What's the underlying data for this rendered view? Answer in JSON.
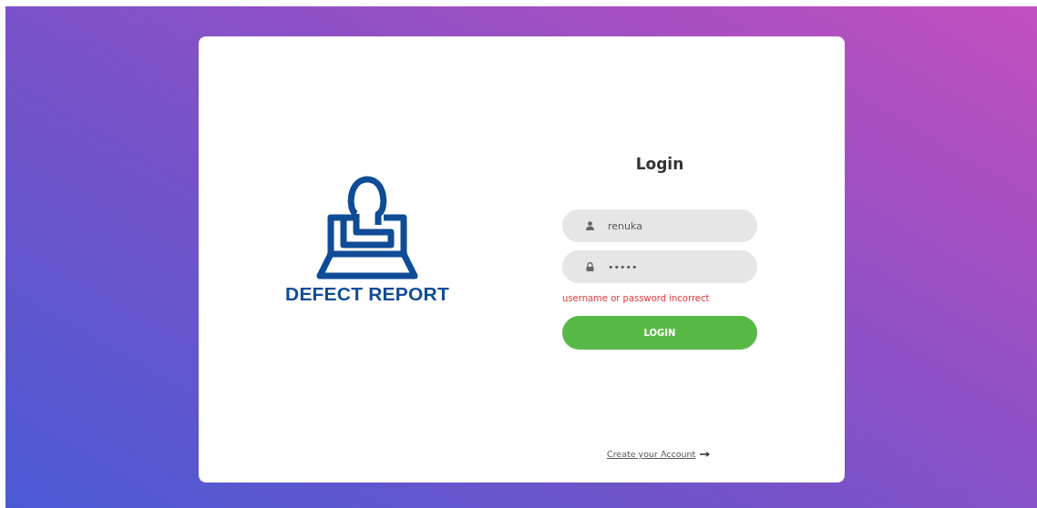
{
  "logo": {
    "text": "DEFECT REPORT"
  },
  "form": {
    "title": "Login",
    "fields": [
      {
        "kind": "user",
        "value": "renuka"
      },
      {
        "kind": "password",
        "value": "•••••"
      }
    ],
    "error": "username or password incorrect",
    "submit": "LOGIN",
    "link": "Create your Account"
  }
}
